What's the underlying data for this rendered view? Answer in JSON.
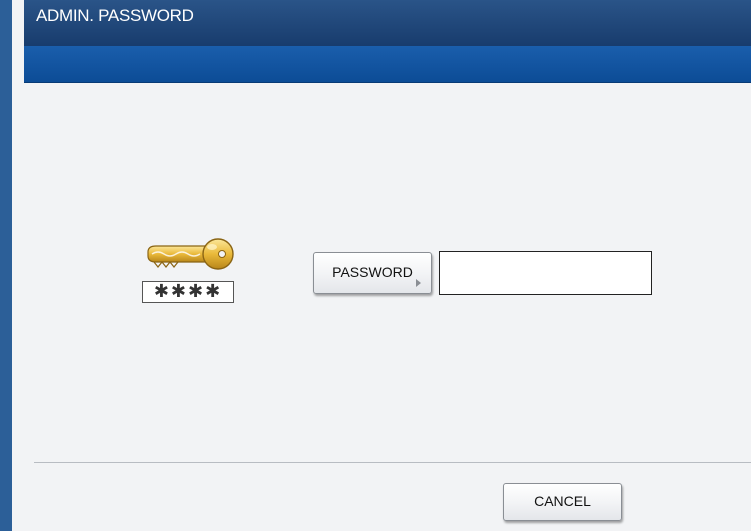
{
  "window": {
    "title": "ADMIN. PASSWORD"
  },
  "login": {
    "key_icon": "key-icon",
    "masked_pin": "✱✱✱✱",
    "password_button_label": "PASSWORD",
    "password_value": ""
  },
  "footer": {
    "cancel_label": "CANCEL"
  },
  "colors": {
    "title_bar": "#1f4679",
    "sub_bar": "#1156a4",
    "window_border": "#2c5f98",
    "key_gold": "#e8b533",
    "background": "#f2f3f5"
  }
}
